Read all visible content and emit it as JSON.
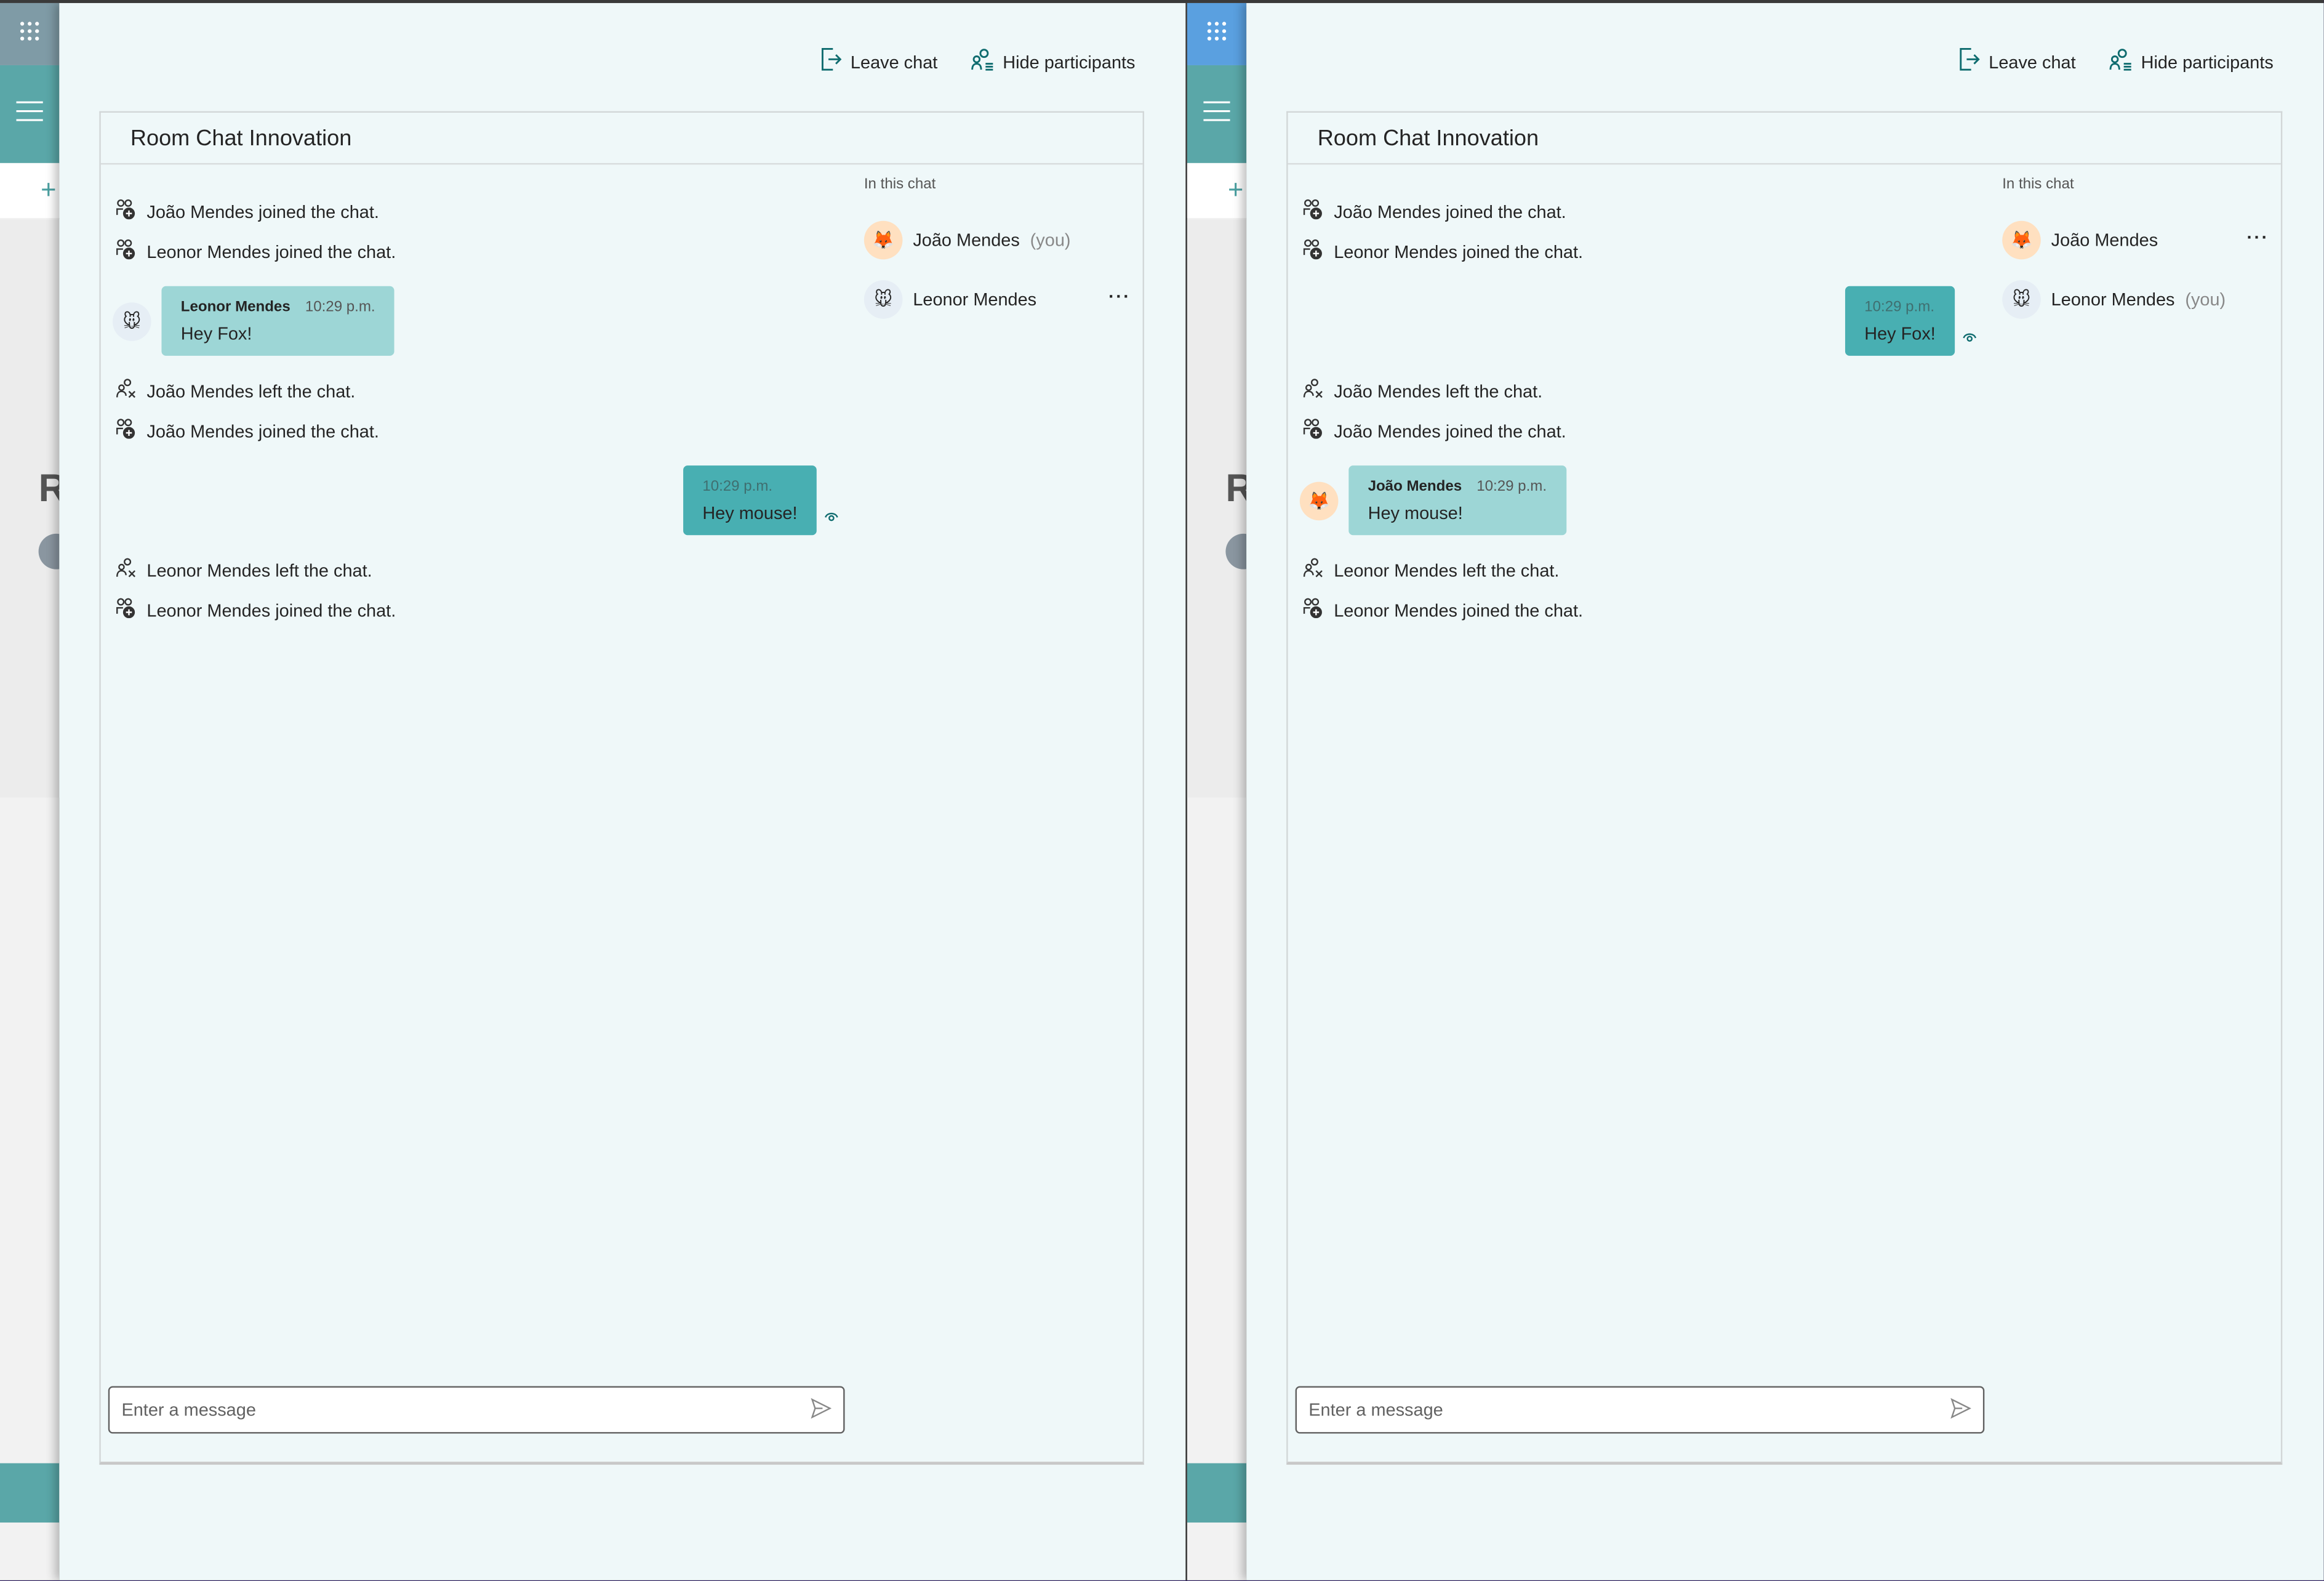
{
  "windows": [
    {
      "leave_label": "Leave chat",
      "hide_label": "Hide participants",
      "title": "Room Chat Innovation",
      "grid_color": "#7f9ba6",
      "events": [
        {
          "type": "system",
          "kind": "joined",
          "text": "João Mendes joined the chat."
        },
        {
          "type": "system",
          "kind": "joined",
          "text": "Leonor Mendes joined the chat."
        },
        {
          "type": "message",
          "own": false,
          "avatar": "mouse",
          "sender": "Leonor Mendes",
          "time": "10:29 p.m.",
          "text": "Hey Fox!"
        },
        {
          "type": "system",
          "kind": "left",
          "text": "João Mendes left the chat."
        },
        {
          "type": "system",
          "kind": "joined",
          "text": "João Mendes joined the chat."
        },
        {
          "type": "message",
          "own": true,
          "time": "10:29 p.m.",
          "text": "Hey mouse!"
        },
        {
          "type": "system",
          "kind": "left",
          "text": "Leonor Mendes left the chat."
        },
        {
          "type": "system",
          "kind": "joined",
          "text": "Leonor Mendes joined the chat."
        }
      ],
      "participants_title": "In this chat",
      "participants": [
        {
          "name": "João Mendes",
          "avatar": "fox",
          "you": "(you)",
          "more": false
        },
        {
          "name": "Leonor Mendes",
          "avatar": "mouse",
          "you": "",
          "more": true
        }
      ],
      "placeholder": "Enter a message"
    },
    {
      "leave_label": "Leave chat",
      "hide_label": "Hide participants",
      "title": "Room Chat Innovation",
      "grid_color": "#5aa0e0",
      "events": [
        {
          "type": "system",
          "kind": "joined",
          "text": "João Mendes joined the chat."
        },
        {
          "type": "system",
          "kind": "joined",
          "text": "Leonor Mendes joined the chat."
        },
        {
          "type": "message",
          "own": true,
          "time": "10:29 p.m.",
          "text": "Hey Fox!"
        },
        {
          "type": "system",
          "kind": "left",
          "text": "João Mendes left the chat."
        },
        {
          "type": "system",
          "kind": "joined",
          "text": "João Mendes joined the chat."
        },
        {
          "type": "message",
          "own": false,
          "avatar": "fox",
          "sender": "João Mendes",
          "time": "10:29 p.m.",
          "text": "Hey mouse!"
        },
        {
          "type": "system",
          "kind": "left",
          "text": "Leonor Mendes left the chat."
        },
        {
          "type": "system",
          "kind": "joined",
          "text": "Leonor Mendes joined the chat."
        }
      ],
      "participants_title": "In this chat",
      "participants": [
        {
          "name": "João Mendes",
          "avatar": "fox",
          "you": "",
          "more": true
        },
        {
          "name": "Leonor Mendes",
          "avatar": "mouse",
          "you": "(you)",
          "more": false
        }
      ],
      "placeholder": "Enter a message"
    }
  ],
  "avatars": {
    "fox": "🦊",
    "mouse": "🐭"
  },
  "more_label": "···",
  "strip_letter": "R",
  "colors": {
    "accent": "#48afb2",
    "bubble_other": "#9dd6d6",
    "panel": "#eff8f9",
    "teal_sidebar": "#5aa7a8"
  }
}
